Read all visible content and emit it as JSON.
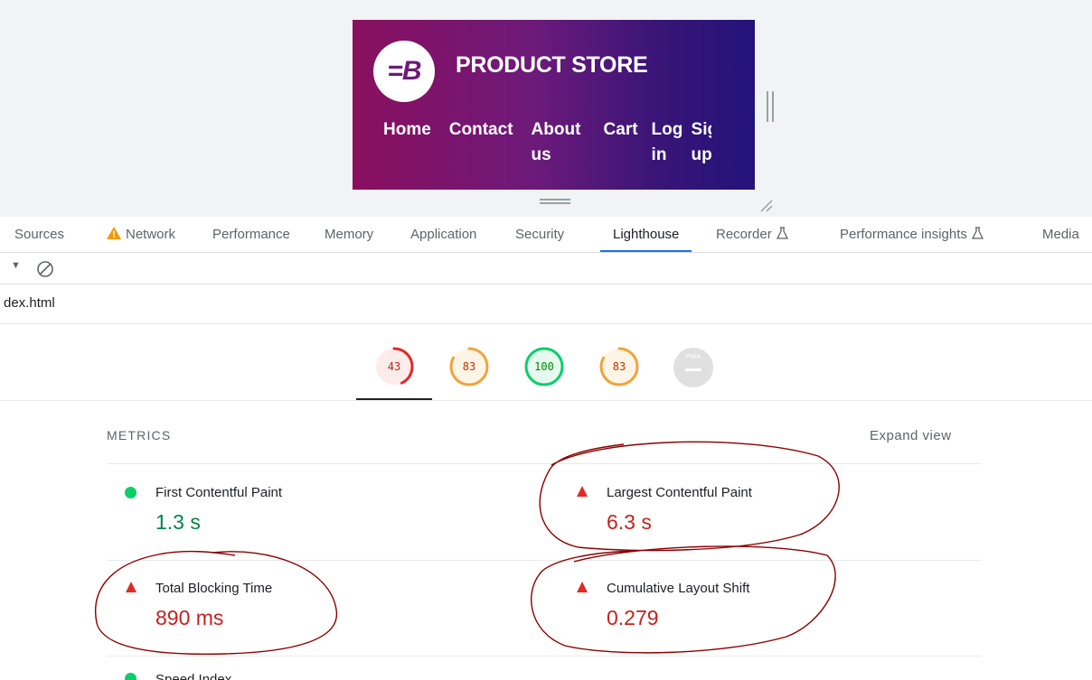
{
  "preview": {
    "store": {
      "logo_text": "=B",
      "title": "PRODUCT STORE",
      "nav": [
        "Home",
        "Contact",
        "About us",
        "Cart",
        "Log in",
        "Sign up"
      ]
    }
  },
  "devtools": {
    "tabs": [
      {
        "label": "Sources",
        "icon": null
      },
      {
        "label": "Network",
        "icon": "warning-icon"
      },
      {
        "label": "Performance",
        "icon": null
      },
      {
        "label": "Memory",
        "icon": null
      },
      {
        "label": "Application",
        "icon": null
      },
      {
        "label": "Security",
        "icon": null
      },
      {
        "label": "Lighthouse",
        "icon": null,
        "active": true
      },
      {
        "label": "Recorder",
        "icon": "flask-icon"
      },
      {
        "label": "Performance insights",
        "icon": "flask-icon"
      },
      {
        "label": "Media",
        "icon": null
      }
    ],
    "toolbar": {
      "dropdown": "▼",
      "clear_icon": "clear-icon"
    },
    "url": "dex.html"
  },
  "lighthouse": {
    "scores": [
      {
        "value": "43",
        "score": 43,
        "color": "#e02b24",
        "bg": "#fdecea"
      },
      {
        "value": "83",
        "score": 83,
        "color": "#f1a33c",
        "bg": "#fff5e6"
      },
      {
        "value": "100",
        "score": 100,
        "color": "#0cce6b",
        "bg": "#e6f9ef"
      },
      {
        "value": "83",
        "score": 83,
        "color": "#f1a33c",
        "bg": "#fff5e6"
      }
    ],
    "pwa_label": "PWA",
    "metrics": {
      "header": "METRICS",
      "expand_label": "Expand view",
      "items": [
        {
          "title": "First Contentful Paint",
          "value": "1.3 s",
          "status": "good"
        },
        {
          "title": "Largest Contentful Paint",
          "value": "6.3 s",
          "status": "bad"
        },
        {
          "title": "Total Blocking Time",
          "value": "890 ms",
          "status": "bad"
        },
        {
          "title": "Cumulative Layout Shift",
          "value": "0.279",
          "status": "bad"
        }
      ],
      "peek_label": "Speed Index"
    }
  }
}
